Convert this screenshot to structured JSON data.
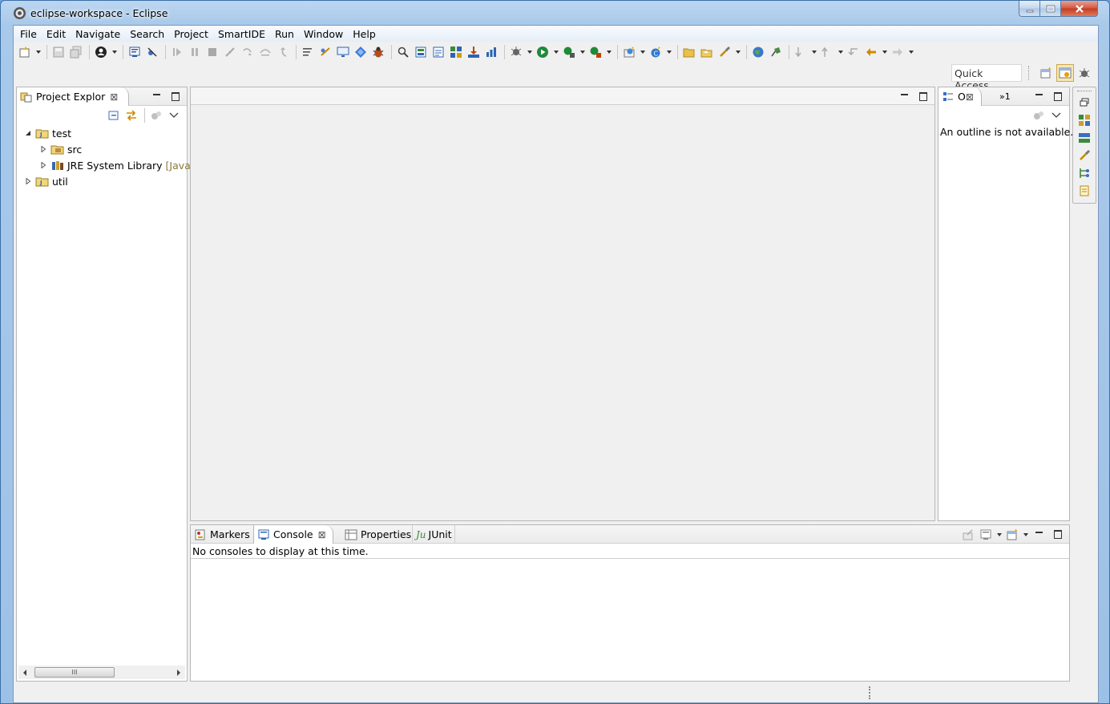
{
  "window": {
    "title": "eclipse-workspace - Eclipse",
    "buttons": [
      "minimize",
      "maximize",
      "close"
    ]
  },
  "menu": [
    "File",
    "Edit",
    "Navigate",
    "Search",
    "Project",
    "SmartIDE",
    "Run",
    "Window",
    "Help"
  ],
  "toolbar": {
    "icons": [
      "new-wizard-icon",
      "save-icon",
      "save-all-icon",
      "profile-icon",
      "terminal-icon",
      "skip-breakpoints-icon",
      "resume-icon",
      "suspend-icon",
      "terminate-icon",
      "disconnect-icon",
      "step-into-icon",
      "step-over-icon",
      "step-return-icon",
      "drop-to-frame-icon",
      "use-step-filters-icon",
      "smartide-monitor-icon",
      "smartide-plugin-icon",
      "bug-icon",
      "search-icon",
      "open-type-icon",
      "open-task-icon",
      "toggle-ant-icon",
      "deploy-icon",
      "chart-icon",
      "debug-icon",
      "run-icon",
      "run-last-icon",
      "coverage-icon",
      "new-java-project-icon",
      "new-java-class-icon",
      "open-folder-icon",
      "open-file-icon",
      "brush-icon",
      "globe-icon",
      "pin-icon",
      "next-annotation-icon",
      "previous-annotation-icon",
      "last-edit-location-icon",
      "back-icon",
      "forward-icon"
    ]
  },
  "quick_access": {
    "placeholder": "Quick Access"
  },
  "project_explorer": {
    "title": "Project Explor",
    "tree": [
      {
        "label": "test",
        "expanded": true,
        "icon": "java-project-icon"
      },
      {
        "label": "src",
        "expanded": false,
        "icon": "source-folder-icon"
      },
      {
        "label": "JRE System Library",
        "decoration": "[JavaS",
        "expanded": false,
        "icon": "library-icon"
      },
      {
        "label": "util",
        "expanded": false,
        "icon": "java-project-icon"
      }
    ],
    "scroll_thumb": "III"
  },
  "outline": {
    "tab_label": "O",
    "overflow_label": "»1",
    "message": "An outline is not available."
  },
  "bottom_panel": {
    "tabs": [
      "Markers",
      "Console",
      "Properties",
      "JUnit"
    ],
    "junit_prefix": "Ju",
    "active_tab": "Console",
    "message": "No consoles to display at this time."
  },
  "colors": {
    "title_gradient": "#a9c9ea",
    "panel_border": "#b7b7b7",
    "active_persp": "#f6e7b5"
  }
}
